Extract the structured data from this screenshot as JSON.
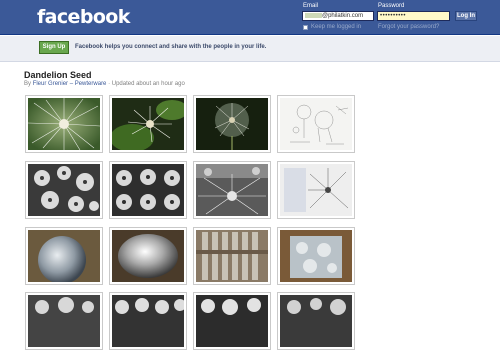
{
  "header": {
    "logo": "facebook",
    "email_label": "Email",
    "email_value": "@philatkin.com",
    "password_label": "Password",
    "password_value": "••••••••••",
    "login_label": "Log In",
    "keep_logged_in": "Keep me logged in",
    "forgot_password": "Forgot your password?"
  },
  "signup": {
    "button": "Sign Up",
    "message": "Facebook helps you connect and share with the people in your life."
  },
  "album": {
    "title": "Dandelion Seed",
    "by": "By",
    "author": "Fleur Grenier",
    "separator": "–",
    "org": "Pewterware",
    "updated": "· Updated about an hour ago"
  },
  "colors": {
    "brand": "#3b5998",
    "signup_green": "#69a74e",
    "signup_bar": "#edeff4"
  },
  "photos": [
    {
      "kind": "seed-bokeh-green"
    },
    {
      "kind": "seed-dark-green"
    },
    {
      "kind": "clock-dark"
    },
    {
      "kind": "sketch"
    },
    {
      "kind": "heads-scatter"
    },
    {
      "kind": "heads-grid"
    },
    {
      "kind": "heads-closeup"
    },
    {
      "kind": "heads-studio"
    },
    {
      "kind": "glass-orb"
    },
    {
      "kind": "silver-egg"
    },
    {
      "kind": "rods-bundle"
    },
    {
      "kind": "box-pack"
    },
    {
      "kind": "heads-row"
    },
    {
      "kind": "heads-row-2"
    },
    {
      "kind": "heads-row-3"
    },
    {
      "kind": "heads-row-4"
    }
  ]
}
